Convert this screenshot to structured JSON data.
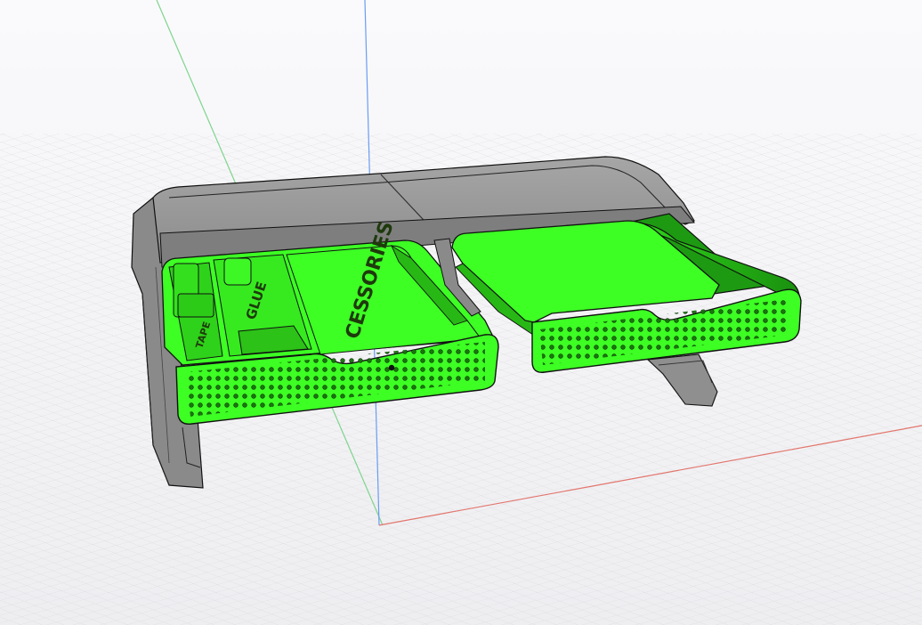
{
  "viewport": {
    "background": "#f5f5f7",
    "grid_color": "#c9c9cf",
    "axis_colors": {
      "x": "#e36b62",
      "y": "#6fd183",
      "z": "#5b8ff0"
    }
  },
  "model": {
    "colors": {
      "shell": "#8e8e8e",
      "shell_dark": "#5f5f5f",
      "lid": "#9a9a9a",
      "drawer": "#3dff24",
      "drawer_dark": "#1f9a12",
      "outline": "#111111"
    },
    "drawer_left": {
      "engraving_main": "CESSORIES",
      "engraving_mid": "GLUE",
      "engraving_small": "TAPE"
    },
    "drawer_right": {}
  }
}
